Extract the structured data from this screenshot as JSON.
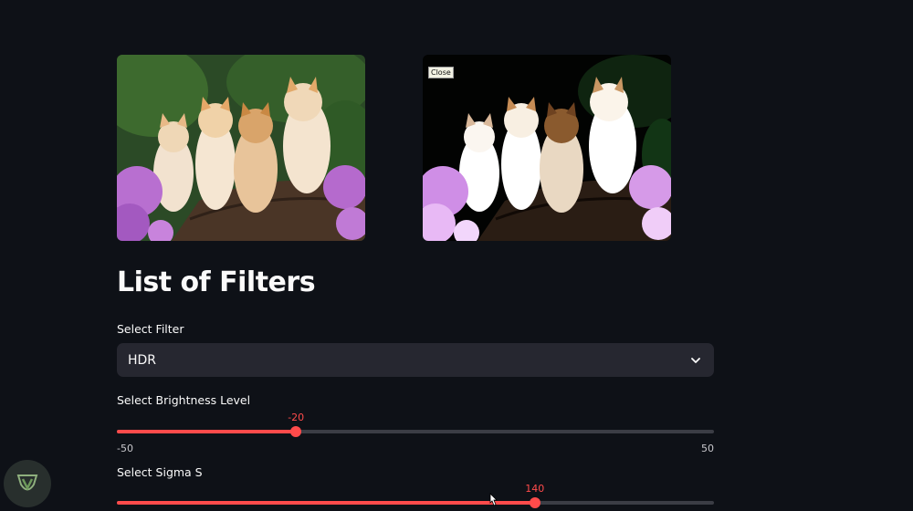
{
  "images": {
    "original": {
      "alt": "kittens original"
    },
    "filtered": {
      "alt": "kittens filtered",
      "close_label": "Close"
    }
  },
  "title": "List of Filters",
  "filter_select": {
    "label": "Select Filter",
    "value": "HDR",
    "icon": "chevron-down-icon"
  },
  "brightness": {
    "label": "Select Brightness Level",
    "value": "-20",
    "min": "-50",
    "max": "50",
    "fraction": 0.3
  },
  "sigma_s": {
    "label": "Select Sigma S",
    "value": "140",
    "fraction": 0.7
  },
  "colors": {
    "background": "#0e1117",
    "accent": "#ff4b4b",
    "input_bg": "#262730"
  }
}
